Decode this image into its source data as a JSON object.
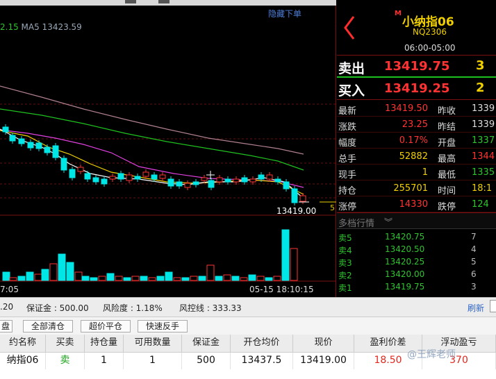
{
  "chart": {
    "hide_orders": "隐藏下单",
    "ma_value_partial": "2.15",
    "ma5_label": "MA5 13423.59",
    "last_price_tag": "13419.00",
    "side_tag": "5",
    "time_left": "7:05",
    "time_right": "05-15 18:10:15",
    "colors": {
      "up": "#ff3333",
      "down": "#00e5e5",
      "ma1": "#ffffff",
      "ma2": "#f0d000",
      "ma3": "#e040e0",
      "ma4": "#1ec21e",
      "ma5": "#b08090",
      "volume": "#00e5e5",
      "volume_up": "#ff3333"
    }
  },
  "quote": {
    "marker": "M",
    "name": "小纳指06",
    "code": "NQ2306",
    "hours": "06:00-05:00",
    "ask": {
      "label": "卖出",
      "price": "13419.75",
      "qty": "3"
    },
    "bid": {
      "label": "买入",
      "price": "13419.25",
      "qty": "2"
    },
    "stats": [
      {
        "l1": "最新",
        "v1": "13419.50",
        "c1": "red",
        "l2": "昨收",
        "v2": "1339",
        "c2": "wht"
      },
      {
        "l1": "涨跌",
        "v1": "23.25",
        "c1": "red",
        "l2": "昨结",
        "v2": "1339",
        "c2": "wht"
      },
      {
        "l1": "幅度",
        "v1": "0.17%",
        "c1": "red",
        "l2": "开盘",
        "v2": "1337",
        "c2": "grn"
      },
      {
        "l1": "总手",
        "v1": "52882",
        "c1": "yel",
        "l2": "最高",
        "v2": "1344",
        "c2": "red"
      },
      {
        "l1": "现手",
        "v1": "1",
        "c1": "yel",
        "l2": "最低",
        "v2": "1335",
        "c2": "grn"
      },
      {
        "l1": "持仓",
        "v1": "255701",
        "c1": "yel",
        "l2": "时间",
        "v2": "18:1",
        "c2": "yel"
      },
      {
        "l1": "涨停",
        "v1": "14330",
        "c1": "red",
        "l2": "跌停",
        "v2": "124",
        "c2": "grn"
      }
    ],
    "depth_title": "多档行情",
    "depth": [
      {
        "label": "卖5",
        "price": "13420.75",
        "qty": "7"
      },
      {
        "label": "卖4",
        "price": "13420.50",
        "qty": "4"
      },
      {
        "label": "卖3",
        "price": "13420.25",
        "qty": "5"
      },
      {
        "label": "卖2",
        "price": "13420.00",
        "qty": "6"
      },
      {
        "label": "卖1",
        "price": "13419.75",
        "qty": "3"
      }
    ]
  },
  "account": {
    "equity_partial": ".20",
    "margin": "保证金 : 500.00",
    "risk": "风险度 : 1.18%",
    "risk_line": "风控线 : 333.33",
    "refresh": "刷新"
  },
  "toolbar": {
    "first_partial": "盘",
    "close_all": "全部清仓",
    "over_close": "超价平仓",
    "reverse": "快速反手"
  },
  "positions": {
    "headers": [
      "约名称",
      "买卖",
      "持仓量",
      "可用数量",
      "保证金",
      "开仓均价",
      "现价",
      "盈利价差",
      "浮动盈亏"
    ],
    "row": [
      "纳指06",
      "卖",
      "1",
      "1",
      "500",
      "13437.5",
      "13419.00",
      "18.50",
      "370"
    ]
  },
  "watermark": "@王辉老师"
}
